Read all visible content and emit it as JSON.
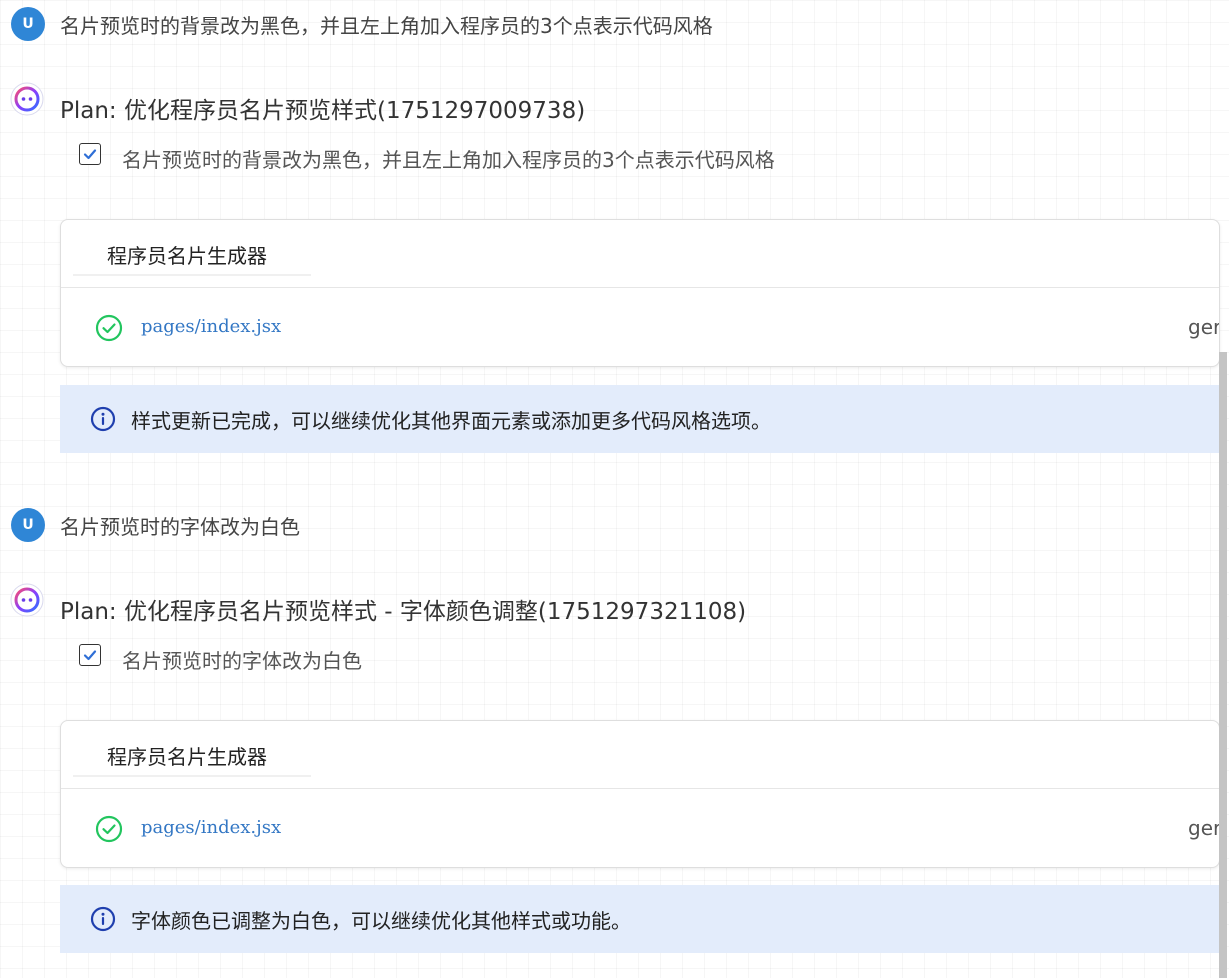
{
  "messages": [
    {
      "user": {
        "avatar": "U",
        "text": "名片预览时的背景改为黑色，并且左上角加入程序员的3个点表示代码风格"
      },
      "plan": {
        "title": "Plan: 优化程序员名片预览样式(1751297009738)",
        "task": "名片预览时的背景改为黑色，并且左上角加入程序员的3个点表示代码风格",
        "task_checked": true
      },
      "card": {
        "title": "程序员名片生成器",
        "file": "pages/index.jsx",
        "tag": "ger"
      },
      "info": {
        "text": "样式更新已完成，可以继续优化其他界面元素或添加更多代码风格选项。"
      }
    },
    {
      "user": {
        "avatar": "U",
        "text": "名片预览时的字体改为白色"
      },
      "plan": {
        "title": "Plan: 优化程序员名片预览样式 - 字体颜色调整(1751297321108)",
        "task": "名片预览时的字体改为白色",
        "task_checked": true
      },
      "card": {
        "title": "程序员名片生成器",
        "file": "pages/index.jsx",
        "tag": "ger"
      },
      "info": {
        "text": "字体颜色已调整为白色，可以继续优化其他样式或功能。"
      }
    }
  ],
  "colors": {
    "user_avatar": "#2f86d6",
    "check_success": "#22c55e",
    "info_bg": "#e3ecfb",
    "info_icon": "#1f3fae",
    "file_link": "#3377c4"
  },
  "icons": {
    "bot_avatar": "bot-icon",
    "checkbox": "checkmark-icon",
    "file_status": "check-circle-icon",
    "info": "info-icon"
  }
}
